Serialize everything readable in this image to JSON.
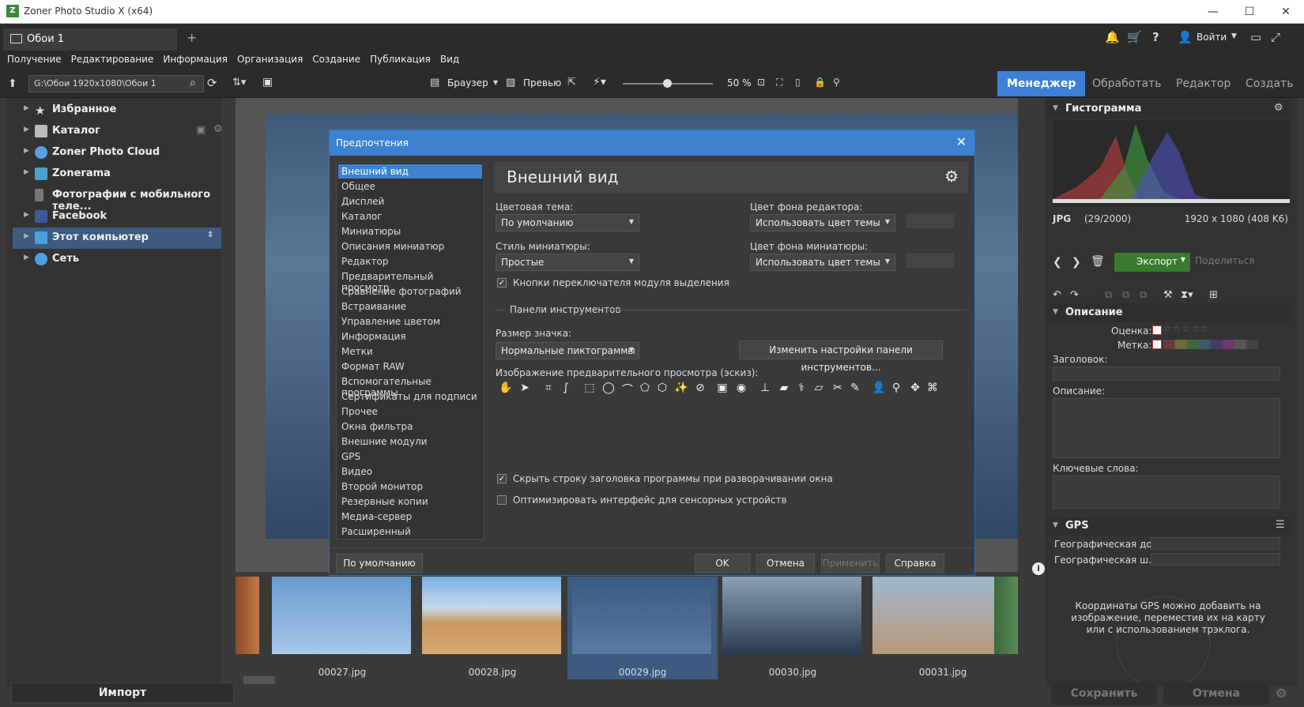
{
  "app": {
    "title": "Zoner Photo Studio X (x64)"
  },
  "tab": {
    "label": "Обои 1"
  },
  "topbar": {
    "login": "Войти"
  },
  "menu": [
    "Получение",
    "Редактирование",
    "Информация",
    "Организация",
    "Создание",
    "Публикация",
    "Вид"
  ],
  "toolbar": {
    "path": "G:\\Обои 1920x1080\\Обои 1",
    "browser": "Браузер",
    "preview": "Превью",
    "zoom": "50 %",
    "zoom_level": 0.5
  },
  "modes": [
    "Менеджер",
    "Обработать",
    "Редактор",
    "Создать"
  ],
  "nav": [
    "Избранное",
    "Каталог",
    "Zoner Photo Cloud",
    "Zonerama",
    "Фотографии с мобильного теле...",
    "Facebook",
    "Этот компьютер",
    "Сеть"
  ],
  "import": "Импорт",
  "thumbs": [
    "00027.jpg",
    "00028.jpg",
    "00029.jpg",
    "00030.jpg",
    "00031.jpg"
  ],
  "right": {
    "histogram": "Гистограмма",
    "fmt": "JPG",
    "count": "(29/2000)",
    "size": "1920 x 1080 (408 K6)",
    "export": "Экспорт",
    "share": "Поделиться",
    "desc_section": "Описание",
    "rating": "Оценка:",
    "label": "Метка:",
    "heading": "Заголовок:",
    "description": "Описание:",
    "keywords": "Ключевые слова:",
    "gps": "GPS",
    "lat": "Географическая до...",
    "lon": "Географическая ш...",
    "gps_note": "Координаты GPS можно добавить на изображение, переместив их на карту или с использованием трэклога.",
    "save": "Сохранить",
    "cancel": "Отмена"
  },
  "dialog": {
    "title": "Предпочтения",
    "items": [
      "Внешний вид",
      "Общее",
      "Дисплей",
      "Каталог",
      "Миниатюры",
      "Описания миниатюр",
      "Редактор",
      "Предварительный просмотр",
      "Сравнение фотографий",
      "Встраивание",
      "Управление цветом",
      "Информация",
      "Метки",
      "Формат RAW",
      "Вспомогательные программы",
      "Сертификаты для подписи",
      "Прочее",
      "Окна фильтра",
      "Внешние модули",
      "GPS",
      "Видео",
      "Второй монитор",
      "Резервные копии",
      "Медиа-сервер",
      "Расширенный"
    ],
    "page_title": "Внешний вид",
    "color_theme_label": "Цветовая тема:",
    "color_theme": "По умолчанию",
    "editor_bg_label": "Цвет фона редактора:",
    "editor_bg": "Использовать цвет темы",
    "thumb_style_label": "Стиль миниатюры:",
    "thumb_style": "Простые",
    "thumb_bg_label": "Цвет фона миниатюры:",
    "thumb_bg": "Использовать цвет темы",
    "chk_switch": "Кнопки переключателя модуля выделения",
    "toolbars_group": "Панели инструментов",
    "icon_size_label": "Размер значка:",
    "icon_size": "Нормальные пиктограммы",
    "change_toolbar": "Изменить настройки панели инструментов...",
    "preview_label": "Изображение предварительного просмотра (эскиз):",
    "chk_hide_title": "Скрыть строку заголовка программы при разворачивании окна",
    "chk_touch": "Оптимизировать интерфейс для сенсорных устройств",
    "btn_default": "По умолчанию",
    "btn_ok": "OK",
    "btn_cancel": "Отмена",
    "btn_apply": "Применить",
    "btn_help": "Справка"
  }
}
